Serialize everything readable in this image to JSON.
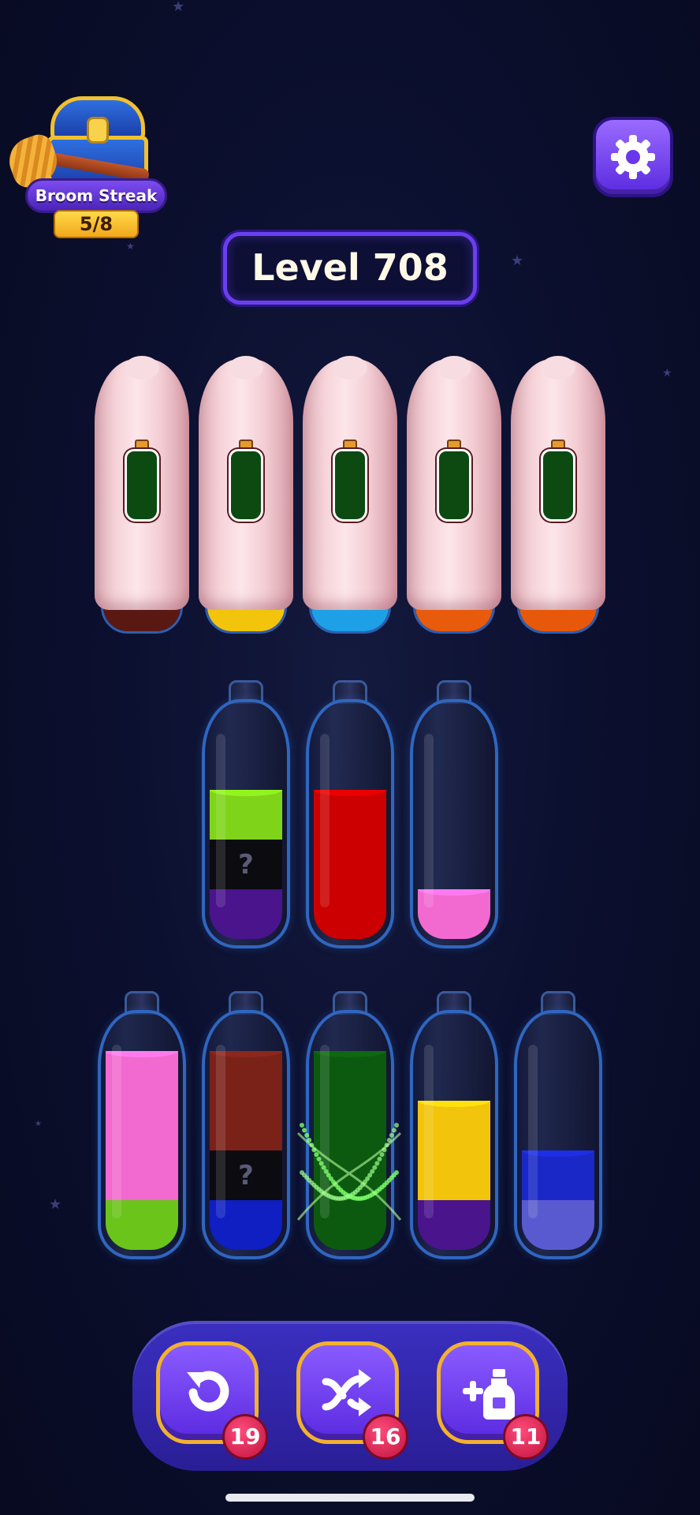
{
  "streak": {
    "label": "Broom Streak",
    "count": "5/8"
  },
  "level": {
    "label": "Level 708"
  },
  "covered_bottles": [
    {
      "base_color": "#5a1812"
    },
    {
      "base_color": "#f2c40c"
    },
    {
      "base_color": "#1ea0e6"
    },
    {
      "base_color": "#e85a0c"
    },
    {
      "base_color": "#e8580a"
    }
  ],
  "row1": [
    {
      "layers": [
        {
          "color": "#4a148c"
        },
        {
          "color": "#0b0b10",
          "hidden": true,
          "mark": "?"
        },
        {
          "color": "#7fd41a"
        }
      ]
    },
    {
      "layers": [
        {
          "color": "#cc0000"
        },
        {
          "color": "#cc0000"
        },
        {
          "color": "#cc0000"
        }
      ]
    },
    {
      "layers": [
        {
          "color": "#f26ad0"
        }
      ]
    }
  ],
  "row2": [
    {
      "layers": [
        {
          "color": "#6ac41a"
        },
        {
          "color": "#f26ad0"
        },
        {
          "color": "#f26ad0"
        },
        {
          "color": "#f26ad0"
        }
      ]
    },
    {
      "layers": [
        {
          "color": "#0f1fc2"
        },
        {
          "color": "#0b0b10",
          "hidden": true,
          "mark": "?"
        },
        {
          "color": "#7a2218"
        },
        {
          "color": "#7a2218"
        }
      ]
    },
    {
      "layers": [
        {
          "color": "#0c5a10"
        },
        {
          "color": "#0c5a10"
        },
        {
          "color": "#0c5a10"
        },
        {
          "color": "#0c5a10"
        }
      ],
      "completed": true
    },
    {
      "layers": [
        {
          "color": "#4a148c"
        },
        {
          "color": "#f2c40c"
        },
        {
          "color": "#f2c40c"
        }
      ]
    },
    {
      "layers": [
        {
          "color": "#5a5ad0"
        },
        {
          "color": "#1a28c8"
        }
      ]
    }
  ],
  "tools": {
    "undo": {
      "count": "19",
      "icon": "undo-icon"
    },
    "shuffle": {
      "count": "16",
      "icon": "shuffle-icon"
    },
    "add_bottle": {
      "count": "11",
      "icon": "add-bottle-icon"
    }
  }
}
